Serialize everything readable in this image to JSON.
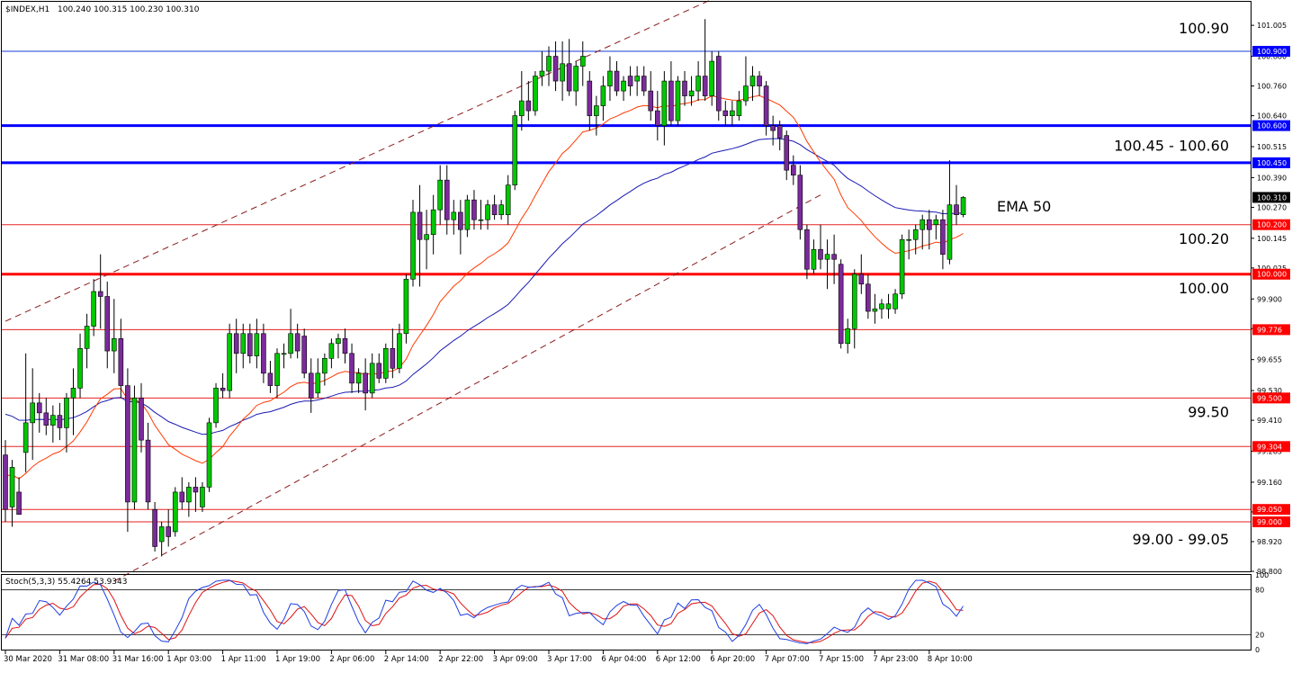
{
  "header": {
    "symbol": "$INDEX,H1",
    "ohlc": "100.240 100.315 100.230 100.310"
  },
  "osc_header": {
    "label": "Stoch(5,3,3) 55.4264 53.9343"
  },
  "colors": {
    "bull": "#00c800",
    "bear": "#7b2b9b",
    "ema_slow": "#1a1ab4",
    "ema_fast": "#ff3b00",
    "level_bold_red": "#ff0000",
    "level_red": "#e52222",
    "level_blue": "#1a3bd9",
    "level_blue_bold": "#0000ff",
    "stoch_main": "#1f3fe0",
    "stoch_signal": "#e01010",
    "channel": "#8b1a1a"
  },
  "chart_data": {
    "type": "candlestick",
    "timeframe": "H1",
    "symbol": "$INDEX",
    "ylim": [
      98.8,
      101.1
    ],
    "y_ticks": [
      "101.005",
      "100.880",
      "100.760",
      "100.640",
      "100.515",
      "100.390",
      "100.270",
      "100.145",
      "100.025",
      "99.900",
      "99.780",
      "99.655",
      "99.530",
      "99.410",
      "99.285",
      "99.160",
      "99.040",
      "98.920",
      "98.800"
    ],
    "x_ticks": [
      "30 Mar 2020",
      "31 Mar 08:00",
      "31 Mar 16:00",
      "1 Apr 03:00",
      "1 Apr 11:00",
      "1 Apr 19:00",
      "2 Apr 06:00",
      "2 Apr 14:00",
      "2 Apr 22:00",
      "3 Apr 09:00",
      "3 Apr 17:00",
      "6 Apr 04:00",
      "6 Apr 12:00",
      "6 Apr 20:00",
      "7 Apr 07:00",
      "7 Apr 15:00",
      "7 Apr 23:00",
      "8 Apr 10:00"
    ],
    "price_levels": [
      {
        "value": 100.9,
        "tag": "100.900",
        "style": "blue-thin"
      },
      {
        "value": 100.6,
        "tag": "100.600",
        "style": "blue-bold"
      },
      {
        "value": 100.45,
        "tag": "100.450",
        "style": "blue-bold"
      },
      {
        "value": 100.2,
        "tag": "100.200",
        "style": "red-thin"
      },
      {
        "value": 100.0,
        "tag": "100.000",
        "style": "red-bold"
      },
      {
        "value": 99.776,
        "tag": "99.776",
        "style": "red-thin"
      },
      {
        "value": 99.5,
        "tag": "99.500",
        "style": "red-thin"
      },
      {
        "value": 99.304,
        "tag": "99.304",
        "style": "red-thin"
      },
      {
        "value": 99.05,
        "tag": "99.050",
        "style": "red-thin"
      },
      {
        "value": 99.0,
        "tag": "99.000",
        "style": "red-thin"
      }
    ],
    "current_price": {
      "value": 100.31,
      "tag": "100.310"
    },
    "annotations": [
      {
        "text": "100.90",
        "value": 100.995
      },
      {
        "text": "100.45 - 100.60",
        "value": 100.52
      },
      {
        "text": "EMA 50",
        "value": 100.275
      },
      {
        "text": "100.20",
        "value": 100.145
      },
      {
        "text": "100.00",
        "value": 99.945
      },
      {
        "text": "99.50",
        "value": 99.445
      },
      {
        "text": "99.00 - 99.05",
        "value": 98.93
      }
    ],
    "channel_lines": [
      {
        "from": [
          0,
          99.81
        ],
        "to": [
          108,
          101.16
        ]
      },
      {
        "from": [
          16,
          98.76
        ],
        "to": [
          120,
          100.32
        ]
      }
    ],
    "candles": [
      {
        "o": 99.27,
        "h": 99.33,
        "l": 99.0,
        "c": 99.05
      },
      {
        "o": 99.06,
        "h": 99.25,
        "l": 98.98,
        "c": 99.22
      },
      {
        "o": 99.12,
        "h": 99.18,
        "l": 99.03,
        "c": 99.03
      },
      {
        "o": 99.28,
        "h": 99.68,
        "l": 99.2,
        "c": 99.4
      },
      {
        "o": 99.4,
        "h": 99.62,
        "l": 99.25,
        "c": 99.48
      },
      {
        "o": 99.48,
        "h": 99.52,
        "l": 99.36,
        "c": 99.44
      },
      {
        "o": 99.44,
        "h": 99.5,
        "l": 99.35,
        "c": 99.39
      },
      {
        "o": 99.39,
        "h": 99.47,
        "l": 99.32,
        "c": 99.43
      },
      {
        "o": 99.43,
        "h": 99.48,
        "l": 99.33,
        "c": 99.38
      },
      {
        "o": 99.38,
        "h": 99.52,
        "l": 99.28,
        "c": 99.5
      },
      {
        "o": 99.5,
        "h": 99.62,
        "l": 99.35,
        "c": 99.54
      },
      {
        "o": 99.54,
        "h": 99.76,
        "l": 99.5,
        "c": 99.7
      },
      {
        "o": 99.7,
        "h": 99.84,
        "l": 99.62,
        "c": 99.79
      },
      {
        "o": 99.79,
        "h": 99.98,
        "l": 99.75,
        "c": 99.93
      },
      {
        "o": 99.93,
        "h": 100.08,
        "l": 99.78,
        "c": 99.91
      },
      {
        "o": 99.91,
        "h": 99.97,
        "l": 99.62,
        "c": 99.69
      },
      {
        "o": 99.69,
        "h": 99.9,
        "l": 99.6,
        "c": 99.74
      },
      {
        "o": 99.74,
        "h": 99.82,
        "l": 99.5,
        "c": 99.55
      },
      {
        "o": 99.55,
        "h": 99.62,
        "l": 98.96,
        "c": 99.08
      },
      {
        "o": 99.08,
        "h": 99.55,
        "l": 99.05,
        "c": 99.5
      },
      {
        "o": 99.5,
        "h": 99.56,
        "l": 99.28,
        "c": 99.33
      },
      {
        "o": 99.33,
        "h": 99.4,
        "l": 99.05,
        "c": 99.08
      },
      {
        "o": 99.05,
        "h": 99.08,
        "l": 98.88,
        "c": 98.9
      },
      {
        "o": 98.92,
        "h": 99.0,
        "l": 98.86,
        "c": 98.98
      },
      {
        "o": 98.98,
        "h": 99.05,
        "l": 98.9,
        "c": 98.94
      },
      {
        "o": 98.96,
        "h": 99.14,
        "l": 98.94,
        "c": 99.12
      },
      {
        "o": 99.12,
        "h": 99.18,
        "l": 99.05,
        "c": 99.08
      },
      {
        "o": 99.08,
        "h": 99.16,
        "l": 99.02,
        "c": 99.14
      },
      {
        "o": 99.14,
        "h": 99.18,
        "l": 99.04,
        "c": 99.12
      },
      {
        "o": 99.06,
        "h": 99.16,
        "l": 99.04,
        "c": 99.14
      },
      {
        "o": 99.14,
        "h": 99.42,
        "l": 99.12,
        "c": 99.4
      },
      {
        "o": 99.4,
        "h": 99.56,
        "l": 99.38,
        "c": 99.54
      },
      {
        "o": 99.54,
        "h": 99.6,
        "l": 99.5,
        "c": 99.53
      },
      {
        "o": 99.53,
        "h": 99.8,
        "l": 99.5,
        "c": 99.76
      },
      {
        "o": 99.76,
        "h": 99.82,
        "l": 99.6,
        "c": 99.68
      },
      {
        "o": 99.68,
        "h": 99.8,
        "l": 99.62,
        "c": 99.76
      },
      {
        "o": 99.76,
        "h": 99.8,
        "l": 99.64,
        "c": 99.67
      },
      {
        "o": 99.67,
        "h": 99.82,
        "l": 99.62,
        "c": 99.76
      },
      {
        "o": 99.76,
        "h": 99.8,
        "l": 99.56,
        "c": 99.6
      },
      {
        "o": 99.6,
        "h": 99.65,
        "l": 99.52,
        "c": 99.55
      },
      {
        "o": 99.55,
        "h": 99.7,
        "l": 99.5,
        "c": 99.68
      },
      {
        "o": 99.68,
        "h": 99.72,
        "l": 99.62,
        "c": 99.68
      },
      {
        "o": 99.68,
        "h": 99.86,
        "l": 99.66,
        "c": 99.76
      },
      {
        "o": 99.76,
        "h": 99.8,
        "l": 99.66,
        "c": 99.69
      },
      {
        "o": 99.75,
        "h": 99.78,
        "l": 99.58,
        "c": 99.6
      },
      {
        "o": 99.6,
        "h": 99.66,
        "l": 99.44,
        "c": 99.5
      },
      {
        "o": 99.52,
        "h": 99.66,
        "l": 99.5,
        "c": 99.6
      },
      {
        "o": 99.6,
        "h": 99.68,
        "l": 99.55,
        "c": 99.66
      },
      {
        "o": 99.66,
        "h": 99.74,
        "l": 99.62,
        "c": 99.72
      },
      {
        "o": 99.72,
        "h": 99.76,
        "l": 99.66,
        "c": 99.74
      },
      {
        "o": 99.74,
        "h": 99.78,
        "l": 99.64,
        "c": 99.68
      },
      {
        "o": 99.68,
        "h": 99.72,
        "l": 99.52,
        "c": 99.56
      },
      {
        "o": 99.56,
        "h": 99.62,
        "l": 99.52,
        "c": 99.6
      },
      {
        "o": 99.6,
        "h": 99.66,
        "l": 99.45,
        "c": 99.52
      },
      {
        "o": 99.52,
        "h": 99.68,
        "l": 99.5,
        "c": 99.64
      },
      {
        "o": 99.64,
        "h": 99.68,
        "l": 99.56,
        "c": 99.58
      },
      {
        "o": 99.58,
        "h": 99.72,
        "l": 99.56,
        "c": 99.7
      },
      {
        "o": 99.7,
        "h": 99.78,
        "l": 99.58,
        "c": 99.62
      },
      {
        "o": 99.62,
        "h": 99.8,
        "l": 99.6,
        "c": 99.76
      },
      {
        "o": 99.76,
        "h": 100.0,
        "l": 99.72,
        "c": 99.98
      },
      {
        "o": 99.98,
        "h": 100.3,
        "l": 99.95,
        "c": 100.25
      },
      {
        "o": 100.25,
        "h": 100.36,
        "l": 99.95,
        "c": 100.14
      },
      {
        "o": 100.14,
        "h": 100.26,
        "l": 100.02,
        "c": 100.16
      },
      {
        "o": 100.16,
        "h": 100.32,
        "l": 100.08,
        "c": 100.26
      },
      {
        "o": 100.26,
        "h": 100.44,
        "l": 100.2,
        "c": 100.38
      },
      {
        "o": 100.38,
        "h": 100.44,
        "l": 100.16,
        "c": 100.22
      },
      {
        "o": 100.22,
        "h": 100.3,
        "l": 100.16,
        "c": 100.25
      },
      {
        "o": 100.25,
        "h": 100.3,
        "l": 100.08,
        "c": 100.18
      },
      {
        "o": 100.18,
        "h": 100.32,
        "l": 100.15,
        "c": 100.3
      },
      {
        "o": 100.3,
        "h": 100.34,
        "l": 100.18,
        "c": 100.22
      },
      {
        "o": 100.22,
        "h": 100.3,
        "l": 100.18,
        "c": 100.22
      },
      {
        "o": 100.22,
        "h": 100.3,
        "l": 100.18,
        "c": 100.28
      },
      {
        "o": 100.28,
        "h": 100.32,
        "l": 100.22,
        "c": 100.24
      },
      {
        "o": 100.24,
        "h": 100.3,
        "l": 100.22,
        "c": 100.28
      },
      {
        "o": 100.24,
        "h": 100.4,
        "l": 100.2,
        "c": 100.36
      },
      {
        "o": 100.36,
        "h": 100.66,
        "l": 100.34,
        "c": 100.64
      },
      {
        "o": 100.64,
        "h": 100.82,
        "l": 100.58,
        "c": 100.7
      },
      {
        "o": 100.7,
        "h": 100.78,
        "l": 100.62,
        "c": 100.66
      },
      {
        "o": 100.66,
        "h": 100.82,
        "l": 100.64,
        "c": 100.8
      },
      {
        "o": 100.8,
        "h": 100.9,
        "l": 100.76,
        "c": 100.82
      },
      {
        "o": 100.82,
        "h": 100.92,
        "l": 100.76,
        "c": 100.88
      },
      {
        "o": 100.88,
        "h": 100.94,
        "l": 100.74,
        "c": 100.78
      },
      {
        "o": 100.78,
        "h": 100.94,
        "l": 100.7,
        "c": 100.85
      },
      {
        "o": 100.85,
        "h": 100.95,
        "l": 100.72,
        "c": 100.74
      },
      {
        "o": 100.74,
        "h": 100.86,
        "l": 100.68,
        "c": 100.84
      },
      {
        "o": 100.84,
        "h": 100.94,
        "l": 100.76,
        "c": 100.88
      },
      {
        "o": 100.78,
        "h": 100.82,
        "l": 100.58,
        "c": 100.64
      },
      {
        "o": 100.64,
        "h": 100.72,
        "l": 100.56,
        "c": 100.68
      },
      {
        "o": 100.68,
        "h": 100.8,
        "l": 100.62,
        "c": 100.76
      },
      {
        "o": 100.76,
        "h": 100.88,
        "l": 100.7,
        "c": 100.82
      },
      {
        "o": 100.82,
        "h": 100.86,
        "l": 100.72,
        "c": 100.74
      },
      {
        "o": 100.74,
        "h": 100.8,
        "l": 100.7,
        "c": 100.78
      },
      {
        "o": 100.8,
        "h": 100.84,
        "l": 100.72,
        "c": 100.76
      },
      {
        "o": 100.78,
        "h": 100.84,
        "l": 100.72,
        "c": 100.8
      },
      {
        "o": 100.8,
        "h": 100.84,
        "l": 100.72,
        "c": 100.74
      },
      {
        "o": 100.74,
        "h": 100.82,
        "l": 100.62,
        "c": 100.66
      },
      {
        "o": 100.66,
        "h": 100.74,
        "l": 100.54,
        "c": 100.6
      },
      {
        "o": 100.6,
        "h": 100.82,
        "l": 100.52,
        "c": 100.78
      },
      {
        "o": 100.78,
        "h": 100.86,
        "l": 100.6,
        "c": 100.62
      },
      {
        "o": 100.62,
        "h": 100.8,
        "l": 100.6,
        "c": 100.78
      },
      {
        "o": 100.78,
        "h": 100.82,
        "l": 100.68,
        "c": 100.72
      },
      {
        "o": 100.72,
        "h": 100.8,
        "l": 100.68,
        "c": 100.74
      },
      {
        "o": 100.74,
        "h": 100.86,
        "l": 100.7,
        "c": 100.8
      },
      {
        "o": 100.8,
        "h": 101.03,
        "l": 100.7,
        "c": 100.72
      },
      {
        "o": 100.72,
        "h": 100.9,
        "l": 100.68,
        "c": 100.86
      },
      {
        "o": 100.88,
        "h": 100.9,
        "l": 100.62,
        "c": 100.66
      },
      {
        "o": 100.66,
        "h": 100.7,
        "l": 100.6,
        "c": 100.64
      },
      {
        "o": 100.64,
        "h": 100.7,
        "l": 100.6,
        "c": 100.66
      },
      {
        "o": 100.64,
        "h": 100.74,
        "l": 100.62,
        "c": 100.7
      },
      {
        "o": 100.7,
        "h": 100.88,
        "l": 100.68,
        "c": 100.76
      },
      {
        "o": 100.76,
        "h": 100.84,
        "l": 100.7,
        "c": 100.8
      },
      {
        "o": 100.8,
        "h": 100.82,
        "l": 100.72,
        "c": 100.76
      },
      {
        "o": 100.76,
        "h": 100.78,
        "l": 100.56,
        "c": 100.6
      },
      {
        "o": 100.6,
        "h": 100.64,
        "l": 100.52,
        "c": 100.58
      },
      {
        "o": 100.6,
        "h": 100.62,
        "l": 100.5,
        "c": 100.55
      },
      {
        "o": 100.56,
        "h": 100.58,
        "l": 100.38,
        "c": 100.42
      },
      {
        "o": 100.44,
        "h": 100.48,
        "l": 100.36,
        "c": 100.4
      },
      {
        "o": 100.4,
        "h": 100.44,
        "l": 100.14,
        "c": 100.18
      },
      {
        "o": 100.18,
        "h": 100.2,
        "l": 99.98,
        "c": 100.02
      },
      {
        "o": 100.02,
        "h": 100.14,
        "l": 100.0,
        "c": 100.1
      },
      {
        "o": 100.1,
        "h": 100.2,
        "l": 100.02,
        "c": 100.06
      },
      {
        "o": 100.06,
        "h": 100.14,
        "l": 99.94,
        "c": 100.08
      },
      {
        "o": 100.08,
        "h": 100.16,
        "l": 99.96,
        "c": 100.06
      },
      {
        "o": 100.04,
        "h": 100.06,
        "l": 99.7,
        "c": 99.72
      },
      {
        "o": 99.72,
        "h": 99.82,
        "l": 99.68,
        "c": 99.78
      },
      {
        "o": 99.78,
        "h": 100.02,
        "l": 99.7,
        "c": 100.0
      },
      {
        "o": 100.0,
        "h": 100.08,
        "l": 99.92,
        "c": 99.96
      },
      {
        "o": 99.96,
        "h": 100.0,
        "l": 99.82,
        "c": 99.85
      },
      {
        "o": 99.85,
        "h": 99.92,
        "l": 99.8,
        "c": 99.86
      },
      {
        "o": 99.86,
        "h": 99.9,
        "l": 99.82,
        "c": 99.88
      },
      {
        "o": 99.86,
        "h": 99.92,
        "l": 99.82,
        "c": 99.88
      },
      {
        "o": 99.86,
        "h": 99.94,
        "l": 99.84,
        "c": 99.92
      },
      {
        "o": 99.92,
        "h": 100.16,
        "l": 99.9,
        "c": 100.14
      },
      {
        "o": 100.14,
        "h": 100.18,
        "l": 100.06,
        "c": 100.14
      },
      {
        "o": 100.14,
        "h": 100.2,
        "l": 100.08,
        "c": 100.18
      },
      {
        "o": 100.18,
        "h": 100.24,
        "l": 100.1,
        "c": 100.22
      },
      {
        "o": 100.22,
        "h": 100.26,
        "l": 100.1,
        "c": 100.18
      },
      {
        "o": 100.2,
        "h": 100.24,
        "l": 100.14,
        "c": 100.22
      },
      {
        "o": 100.22,
        "h": 100.26,
        "l": 100.02,
        "c": 100.08
      },
      {
        "o": 100.06,
        "h": 100.46,
        "l": 100.04,
        "c": 100.28
      },
      {
        "o": 100.28,
        "h": 100.36,
        "l": 100.2,
        "c": 100.24
      },
      {
        "o": 100.24,
        "h": 100.315,
        "l": 100.23,
        "c": 100.31
      }
    ],
    "ema_fast_period": 20,
    "ema_slow_period": 50,
    "ema_slow_seed": 99.45,
    "ema_fast_seed": 99.2,
    "indicator": {
      "name": "Stoch(5,3,3)",
      "main_last": 55.4264,
      "signal_last": 53.9343,
      "levels": [
        80,
        20
      ],
      "ylim": [
        0,
        100
      ],
      "tick_labels": [
        "100",
        "80",
        "20",
        "0"
      ]
    }
  }
}
